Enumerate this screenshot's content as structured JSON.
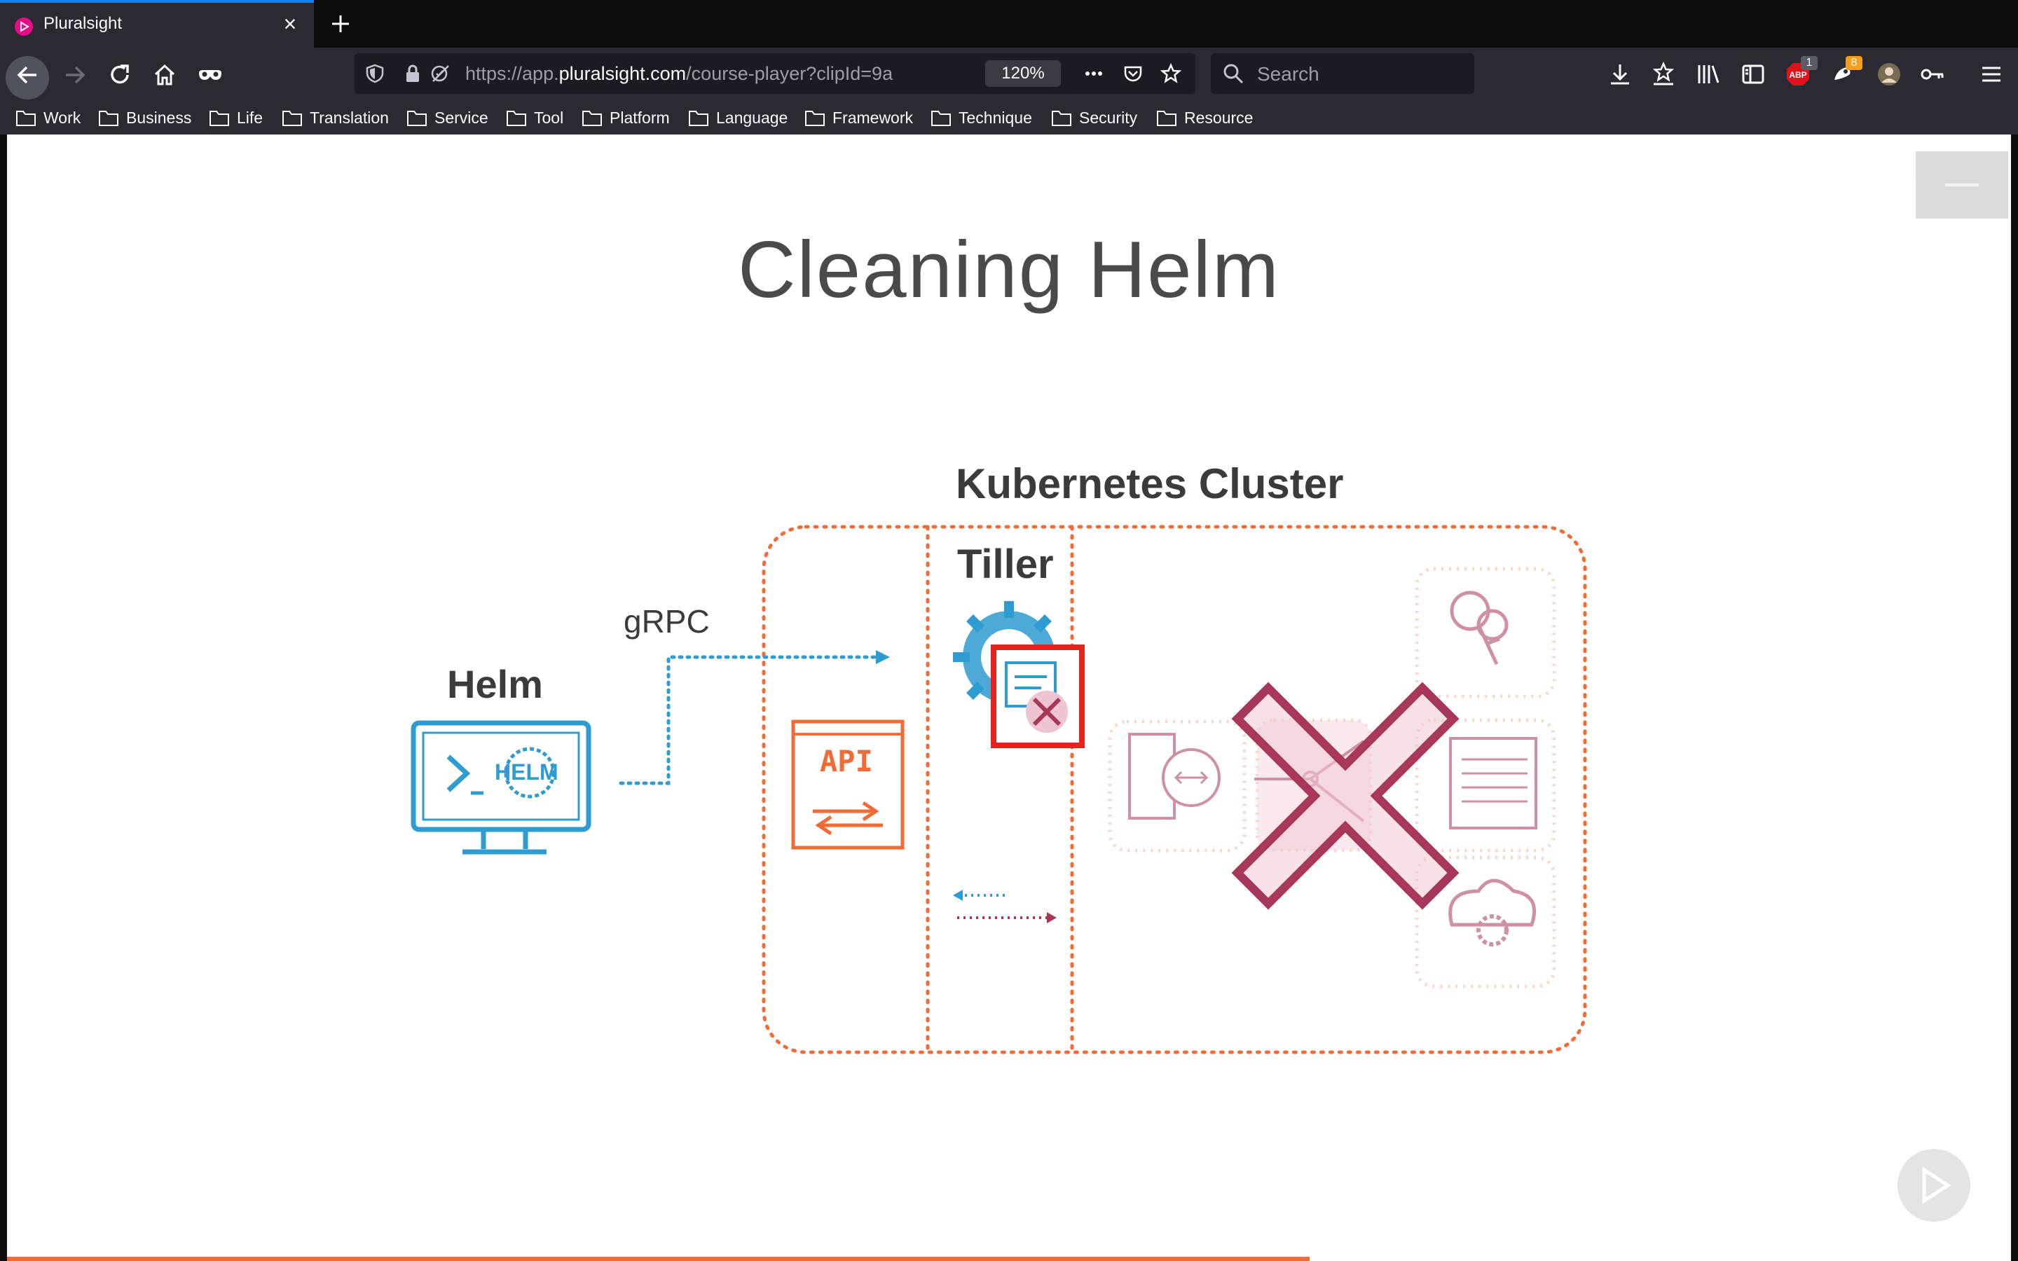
{
  "browser": {
    "tab": {
      "title": "Pluralsight",
      "close_glyph": "×"
    },
    "url": {
      "prefix": "https://app.",
      "host": "pluralsight.com",
      "path": "/course-player?clipId=9a"
    },
    "zoom": "120%",
    "search_placeholder": "Search",
    "badges": {
      "adblock": "1",
      "extension": "8"
    },
    "bookmarks": [
      "Work",
      "Business",
      "Life",
      "Translation",
      "Service",
      "Tool",
      "Platform",
      "Language",
      "Framework",
      "Technique",
      "Security",
      "Resource"
    ]
  },
  "slide": {
    "title": "Cleaning Helm",
    "cluster_label": "Kubernetes Cluster",
    "tiller_label": "Tiller",
    "helm_label": "Helm",
    "grpc_label": "gRPC",
    "api_label": "API",
    "helm_logo_text": "HELM"
  },
  "player": {
    "progress": 0.65
  },
  "colors": {
    "accent_orange": "#f26b36",
    "helm_blue": "#2e9bd1",
    "delete_red": "#e8231e",
    "cross_red": "#a8375a",
    "faded_pink": "#d9a3b5"
  },
  "icons": [
    "pluralsight-icon",
    "back-icon",
    "forward-icon",
    "reload-icon",
    "home-icon",
    "mask-icon",
    "shield-icon",
    "lock-icon",
    "permissions-icon",
    "more-icon",
    "pocket-icon",
    "star-icon",
    "search-icon",
    "download-icon",
    "bookmarks-icon",
    "library-icon",
    "sidebar-icon",
    "adblock-icon",
    "extension-icon",
    "avatar-icon",
    "key-icon",
    "menu-icon",
    "folder-icon"
  ]
}
